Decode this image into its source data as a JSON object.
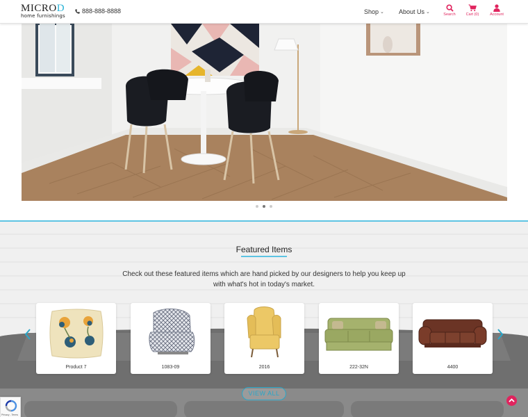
{
  "header": {
    "logo_main": "MICRO",
    "logo_accent": "D",
    "logo_sub": "home furnishings",
    "phone": "888-888-8888",
    "nav": [
      {
        "label": "Shop"
      },
      {
        "label": "About Us"
      }
    ],
    "utilities": [
      {
        "label": "Search",
        "icon": "search-icon"
      },
      {
        "label": "Cart (0)",
        "icon": "cart-icon"
      },
      {
        "label": "Account",
        "icon": "account-icon"
      }
    ],
    "accent_color": "#e0245e"
  },
  "hero": {
    "slide_count": 3,
    "active_slide": 2
  },
  "featured": {
    "title": "Featured Items",
    "description": "Check out these featured items which are hand picked by our designers to help you keep up with what's hot in today's market.",
    "items": [
      {
        "label": "Product 7"
      },
      {
        "label": "1083-09"
      },
      {
        "label": "2016"
      },
      {
        "label": "222-32N"
      },
      {
        "label": "4400"
      }
    ],
    "view_all_label": "VIEW ALL",
    "accent_color": "#2aa6c8"
  },
  "recaptcha": {
    "text": "Privacy - Terms"
  }
}
